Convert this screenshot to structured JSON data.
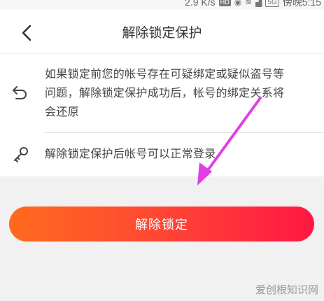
{
  "status_bar": {
    "speed": "2.9 K/s",
    "hd_badge": "HD",
    "network_badge": "5G",
    "time": "傍晚5:15",
    "icons": [
      "eye-icon",
      "wifi-icon",
      "signal-icon",
      "battery-icon"
    ]
  },
  "header": {
    "back_icon": "chevron-left-icon",
    "title": "解除锁定保护"
  },
  "info": {
    "items": [
      {
        "icon": "undo-icon",
        "lines": [
          "如果锁定前您的帐号存在可疑绑定或疑似盗号等",
          "问题，解除锁定保护成功后，帐号的绑定关系将",
          "会还原"
        ]
      },
      {
        "icon": "key-icon",
        "text": "解除锁定保护后帐号可以正常登录"
      }
    ]
  },
  "action": {
    "unlock_label": "解除锁定"
  },
  "annotation": {
    "arrow_color": "#e23de6"
  },
  "watermark": {
    "text": "爱创根知识网"
  },
  "colors": {
    "button_gradient_start": "#ff6a1e",
    "button_gradient_end": "#ff1844",
    "background": "#f1f1f1"
  }
}
